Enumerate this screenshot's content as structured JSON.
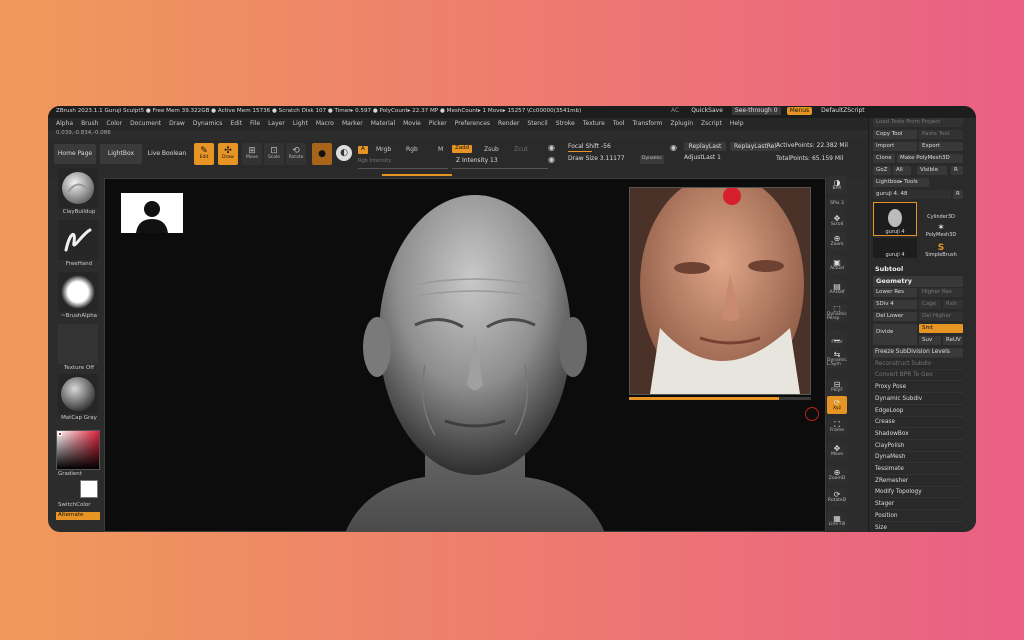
{
  "titlebar": {
    "status": "ZBrush 2023.1.1   Guruji Sculpt5   ● Free Mem 39.322GB ● Active Mem 15736 ● Scratch Disk 107 ● Timer▸ 0.597 ● PolyCount▸ 22.37 MP ● MeshCount▸ 1  Move▸ 15257 \\Cc00000(3541mb)",
    "ac": "AC",
    "quicksave": "QuickSave",
    "see_through": "See-through  0",
    "menus": "Menus",
    "default_script": "DefaultZScript"
  },
  "menubar": [
    "Alpha",
    "Brush",
    "Color",
    "Document",
    "Draw",
    "Dynamics",
    "Edit",
    "File",
    "Layer",
    "Light",
    "Macro",
    "Marker",
    "Material",
    "Movie",
    "Picker",
    "Preferences",
    "Render",
    "Stencil",
    "Stroke",
    "Texture",
    "Tool",
    "Transform",
    "Zplugin",
    "Zscript",
    "Help"
  ],
  "coords": "0.039,-0.834,-0.086",
  "toolbar": {
    "home_page": "Home Page",
    "lightbox": "LightBox",
    "live_boolean": "Live Boolean",
    "edit": "Edit",
    "draw": "Draw",
    "move": "Move",
    "scale": "Scale",
    "rotate": "Rotate",
    "a": "A",
    "mrgb": "Mrgb",
    "rgb": "Rgb",
    "m": "M",
    "rgb_intensity": "Rgb Intensity",
    "zadd": "Zadd",
    "zsub": "Zsub",
    "zcut": "Zcut",
    "z_intensity": "Z Intensity 13",
    "focal_shift": "Focal Shift -56",
    "draw_size": "Draw Size 3.11177",
    "dynamic": "Dynamic",
    "replay_last": "ReplayLast",
    "replay_last_rel": "ReplayLastRel",
    "adjust_last": "AdjustLast 1",
    "active_points": "ActivePoints: 22.382 Mil",
    "total_points": "TotalPoints: 65.159 Mil"
  },
  "left_shelf": {
    "brush1": "ClayBuildup",
    "brush2": "FreeHand",
    "alpha": "~BrushAlpha",
    "texture": "Texture Off",
    "material": "MatCap Gray",
    "gradient": "Gradient",
    "switch_color": "SwitchColor",
    "alternate": "Alternate"
  },
  "right_strip": [
    "BPR",
    "SPix 3",
    "Scroll",
    "Zoom",
    "Actual",
    "AAHalf",
    "Dynamic Persp",
    "Floor",
    "Dynamic L.Sym",
    "PolyF",
    "Xyz",
    "Frame",
    "Move",
    "ZoomD",
    "RotateD",
    "Line Fill"
  ],
  "right_panel": {
    "load_tools": "Load Tools From Project",
    "copy_tool": "Copy Tool",
    "paste_tool": "Paste Tool",
    "import": "Import",
    "export": "Export",
    "clone": "Clone",
    "make_polymesh": "Make PolyMesh3D",
    "goz": "GoZ",
    "all": "All",
    "visible": "Visible",
    "r": "R",
    "lightbox_tools": "Lightbox▸ Tools",
    "guruji_slider": "guruji 4. 48",
    "thumb1": "guruji 4",
    "thumb2": "Cylinder3D",
    "thumb3": "PolyMesh3D",
    "thumb4": "guruji 4",
    "thumb5": "SimpleBrush",
    "subtool": "Subtool",
    "geometry": "Geometry",
    "lower_res": "Lower Res",
    "higher_res": "Higher Res",
    "sdiv": "SDiv 4",
    "cage": "Cage",
    "rstr": "Rstr",
    "del_lower": "Del Lower",
    "del_higher": "Del Higher",
    "divide": "Divide",
    "smt": "Smt",
    "suv": "Suv",
    "reuv": "ReUV",
    "items": [
      "Freeze SubDivision Levels",
      "Reconstruct Subdiv",
      "Convert BPR To Geo",
      "Proxy Pose",
      "Dynamic Subdiv",
      "EdgeLoop",
      "Crease",
      "ShadowBox",
      "ClayPolish",
      "DynaMesh",
      "Tessimate",
      "ZRemesher",
      "Modify Topology",
      "Stager",
      "Position",
      "Size"
    ]
  }
}
